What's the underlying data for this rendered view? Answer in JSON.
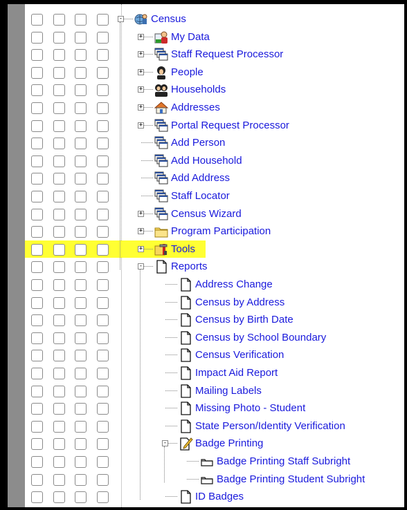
{
  "tree": {
    "root": {
      "label": "Census",
      "icon": "census-globe-icon"
    },
    "items": [
      {
        "label": "My Data",
        "icon": "my-data-person-icon",
        "expandable": true
      },
      {
        "label": "Staff Request Processor",
        "icon": "stacked-windows-icon",
        "expandable": true
      },
      {
        "label": "People",
        "icon": "person-silhouette-icon",
        "expandable": true
      },
      {
        "label": "Households",
        "icon": "household-people-icon",
        "expandable": true
      },
      {
        "label": "Addresses",
        "icon": "house-icon",
        "expandable": true
      },
      {
        "label": "Portal Request Processor",
        "icon": "stacked-windows-icon",
        "expandable": true
      },
      {
        "label": "Add Person",
        "icon": "stacked-windows-icon",
        "expandable": false
      },
      {
        "label": "Add Household",
        "icon": "stacked-windows-icon",
        "expandable": false
      },
      {
        "label": "Add Address",
        "icon": "stacked-windows-icon",
        "expandable": false
      },
      {
        "label": "Staff Locator",
        "icon": "stacked-windows-icon",
        "expandable": false
      },
      {
        "label": "Census Wizard",
        "icon": "stacked-windows-icon",
        "expandable": true
      },
      {
        "label": "Program Participation",
        "icon": "folder-icon",
        "expandable": true
      },
      {
        "label": "Tools",
        "icon": "toolbox-icon",
        "expandable": true,
        "highlighted": true
      }
    ],
    "reports": {
      "label": "Reports",
      "icon": "document-icon",
      "items": [
        {
          "label": "Address Change",
          "icon": "document-icon"
        },
        {
          "label": "Census by Address",
          "icon": "document-icon"
        },
        {
          "label": "Census by Birth Date",
          "icon": "document-icon"
        },
        {
          "label": "Census by School Boundary",
          "icon": "document-icon"
        },
        {
          "label": "Census Verification",
          "icon": "document-icon"
        },
        {
          "label": "Impact Aid Report",
          "icon": "document-icon"
        },
        {
          "label": "Mailing Labels",
          "icon": "document-icon"
        },
        {
          "label": "Missing Photo - Student",
          "icon": "document-icon"
        },
        {
          "label": "State Person/Identity Verification",
          "icon": "document-icon"
        }
      ],
      "badge_printing": {
        "label": "Badge Printing",
        "icon": "edit-document-icon",
        "items": [
          {
            "label": "Badge Printing Staff Subright",
            "icon": "subright-icon"
          },
          {
            "label": "Badge Printing Student Subright",
            "icon": "subright-icon"
          }
        ]
      },
      "id_badges": {
        "label": "ID Badges",
        "icon": "document-icon"
      }
    }
  },
  "colors": {
    "link": "#1a1adc",
    "highlight": "#ffff33",
    "gutter": "#8c8c8c"
  }
}
